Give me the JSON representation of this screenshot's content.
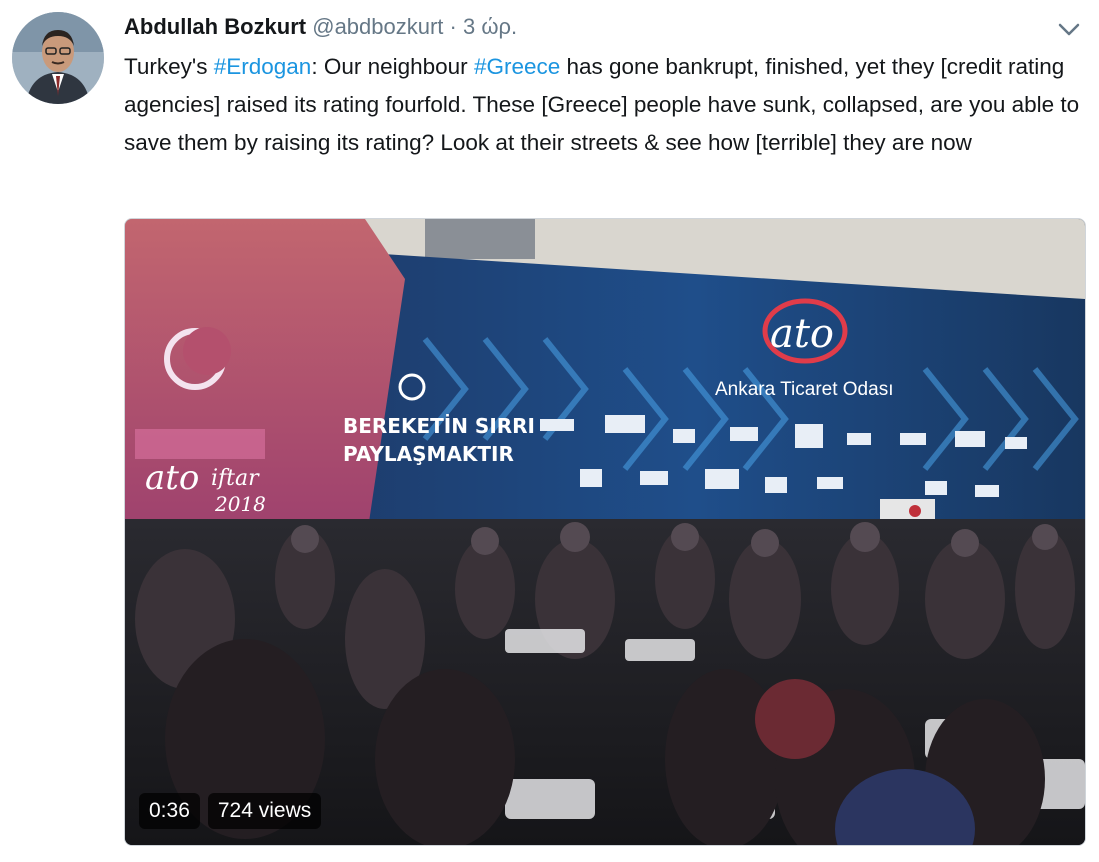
{
  "tweet": {
    "author_name": "Abdullah Bozkurt",
    "handle": "@abdbozkurt",
    "separator": "·",
    "time": "3 ώρ.",
    "text_parts": [
      {
        "t": "Turkey's ",
        "tag": false
      },
      {
        "t": "#Erdogan",
        "tag": true
      },
      {
        "t": ": Our neighbour ",
        "tag": false
      },
      {
        "t": "#Greece",
        "tag": true
      },
      {
        "t": " has gone bankrupt, finished, yet they [credit rating agencies] raised its rating fourfold. These [Greece] people have sunk, collapsed, are you able to save them by raising its rating? Look at their streets & see how [terrible] they are now",
        "tag": false
      }
    ]
  },
  "video": {
    "duration": "0:36",
    "views": "724 views",
    "scene_text": {
      "logo": "ato",
      "org": "Ankara Ticaret Odası",
      "banner_line1": "BEREKETİN SIRRI",
      "banner_line2": "PAYLAŞMAKTIR",
      "side_logo": "ato",
      "side_event": "iftar",
      "side_year": "2018"
    }
  },
  "colors": {
    "hashtag": "#1b95e0",
    "muted": "#657786",
    "text": "#14171a"
  },
  "icons": {
    "caret": "chevron-down-icon"
  }
}
